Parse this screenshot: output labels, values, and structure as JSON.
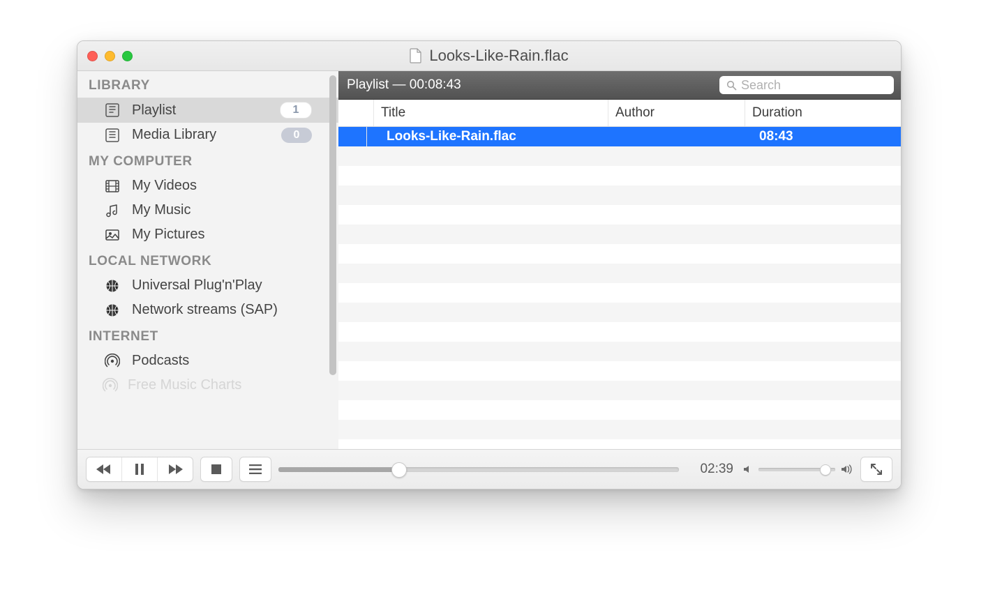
{
  "window": {
    "title": "Looks-Like-Rain.flac"
  },
  "sidebar": {
    "sections": [
      {
        "header": "LIBRARY",
        "items": [
          {
            "name": "playlist",
            "icon": "playlist-icon",
            "label": "Playlist",
            "badge": "1",
            "badgeStyle": "light",
            "selected": true
          },
          {
            "name": "media-library",
            "icon": "library-icon",
            "label": "Media Library",
            "badge": "0",
            "badgeStyle": "dim"
          }
        ]
      },
      {
        "header": "MY COMPUTER",
        "items": [
          {
            "name": "my-videos",
            "icon": "film-icon",
            "label": "My Videos"
          },
          {
            "name": "my-music",
            "icon": "music-icon",
            "label": "My Music"
          },
          {
            "name": "my-pictures",
            "icon": "picture-icon",
            "label": "My Pictures"
          }
        ]
      },
      {
        "header": "LOCAL NETWORK",
        "items": [
          {
            "name": "upnp",
            "icon": "globe-icon",
            "label": "Universal Plug'n'Play"
          },
          {
            "name": "sap",
            "icon": "globe-icon",
            "label": "Network streams (SAP)"
          }
        ]
      },
      {
        "header": "INTERNET",
        "items": [
          {
            "name": "podcasts",
            "icon": "podcast-icon",
            "label": "Podcasts"
          }
        ],
        "clipped": {
          "icon": "podcast-icon",
          "label": "Free Music Charts"
        }
      }
    ]
  },
  "playlist": {
    "headerPrefix": "Playlist",
    "headerSep": " — ",
    "totalDuration": "00:08:43",
    "searchPlaceholder": "Search",
    "columns": {
      "title": "Title",
      "author": "Author",
      "duration": "Duration"
    },
    "rows": [
      {
        "title": "Looks-Like-Rain.flac",
        "author": "",
        "duration": "08:43"
      }
    ]
  },
  "player": {
    "elapsed": "02:39",
    "progressPercent": 30,
    "volumePercent": 86
  }
}
